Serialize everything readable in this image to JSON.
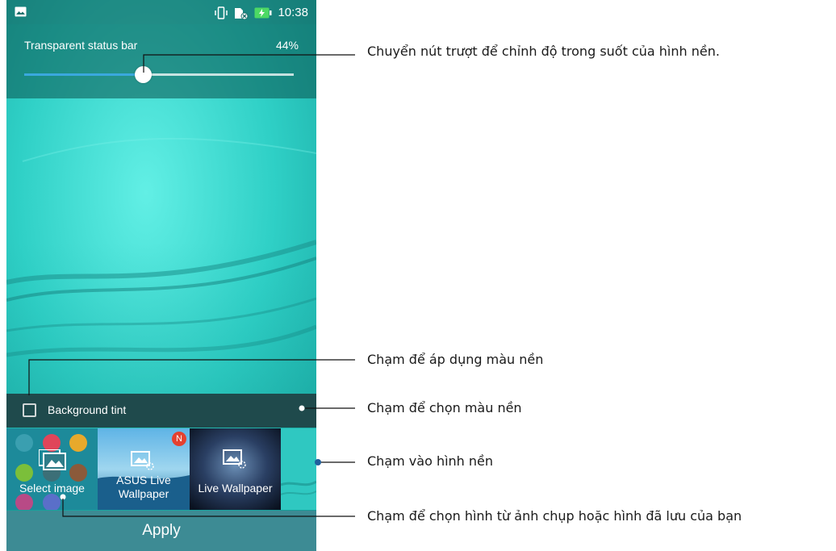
{
  "status_bar": {
    "time": "10:38"
  },
  "slider": {
    "label": "Transparent status bar",
    "value_text": "44%",
    "value_fraction": 0.44,
    "fill_color": "#3aa8de"
  },
  "tint": {
    "label": "Background tint",
    "checked": false
  },
  "wallpapers": [
    {
      "label": "Select image"
    },
    {
      "label_line1": "ASUS Live",
      "label_line2": "Wallpaper",
      "badge": "N"
    },
    {
      "label": "Live Wallpaper"
    }
  ],
  "apply": {
    "label": "Apply"
  },
  "callouts": [
    "Chuyển nút trượt để chỉnh độ trong suốt của hình nền.",
    "Chạm để áp dụng màu nền",
    "Chạm để chọn màu nền",
    "Chạm vào hình nền",
    "Chạm để chọn hình từ ảnh chụp hoặc hình đã lưu của bạn"
  ],
  "icons": {
    "status_left": "image-icon",
    "status_vibrate": "vibrate-icon",
    "status_sim": "no-sim-icon",
    "status_battery": "battery-charging-icon",
    "thumb_image": "image-icon",
    "thumb_loading": "loading-icon"
  }
}
